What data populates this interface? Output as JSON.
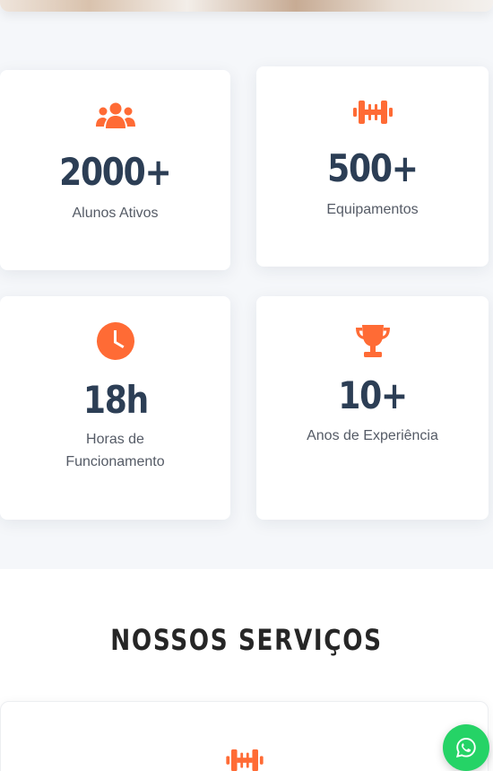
{
  "stats": [
    {
      "icon": "users-icon",
      "value": "2000+",
      "label": "Alunos Ativos"
    },
    {
      "icon": "dumbbell-icon",
      "value": "500+",
      "label": "Equipamentos"
    },
    {
      "icon": "clock-icon",
      "value": "18h",
      "label_line1": "Horas de",
      "label_line2": "Funcionamento"
    },
    {
      "icon": "trophy-icon",
      "value": "10+",
      "label": "Anos de Experiência"
    }
  ],
  "services": {
    "title": "NOSSOS SERVIÇOS",
    "first_card_icon": "dumbbell-icon"
  },
  "whatsapp": {
    "icon": "whatsapp-icon"
  },
  "colors": {
    "accent": "#ff6b35",
    "number": "#2c3e55",
    "whatsapp": "#25d366"
  }
}
